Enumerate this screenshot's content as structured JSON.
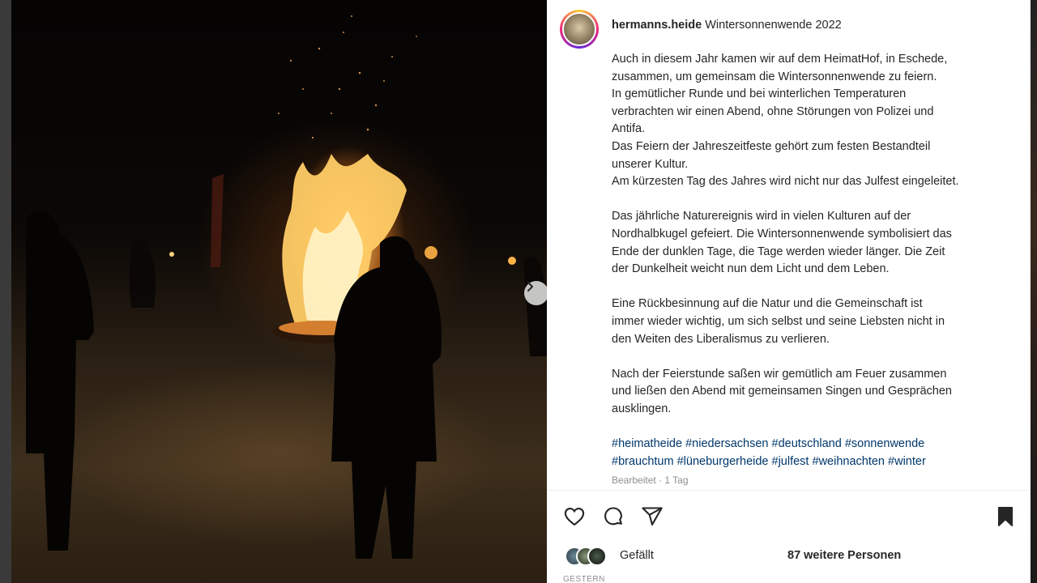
{
  "post": {
    "username": "hermanns.heide",
    "title": "Wintersonnenwende 2022",
    "caption_lines": [
      "Auch in diesem Jahr kamen wir auf dem HeimatHof, in Eschede,",
      "zusammen, um gemeinsam die Wintersonnenwende zu feiern.",
      "In gemütlicher Runde und bei winterlichen Temperaturen",
      "verbrachten wir einen Abend, ohne Störungen von Polizei und",
      "Antifa.",
      "Das Feiern der Jahreszeitfeste gehört zum festen Bestandteil",
      "unserer Kultur.",
      "Am kürzesten Tag des Jahres wird nicht nur das Julfest eingeleitet."
    ],
    "paragraph2_lines": [
      "Das jährliche Naturereignis wird in vielen Kulturen auf der",
      "Nordhalbkugel gefeiert. Die Wintersonnenwende symbolisiert das",
      "Ende der dunklen Tage, die Tage werden wieder länger. Die Zeit",
      "der Dunkelheit weicht nun dem Licht und dem Leben."
    ],
    "paragraph3_lines": [
      "Eine Rückbesinnung auf die Natur und die Gemeinschaft ist",
      "immer wieder wichtig, um sich selbst und seine Liebsten nicht in",
      "den Weiten des Liberalismus zu verlieren."
    ],
    "paragraph4_lines": [
      "Nach der Feierstunde saßen wir gemütlich am Feuer zusammen",
      "und ließen den Abend mit gemeinsamen Singen und Gesprächen",
      "ausklingen."
    ],
    "hashtags_line1": [
      "#heimatheide",
      "#niedersachsen",
      "#deutschland",
      "#sonnenwende"
    ],
    "hashtags_line2": [
      "#brauchtum",
      "#lüneburgerheide",
      "#julfest",
      "#weihnachten",
      "#winter"
    ],
    "edited": "Bearbeitet · 1 Tag",
    "liked_by_prefix": "Gefällt",
    "liked_by_rest": "87 weitere Personen",
    "timestamp": "GESTERN"
  },
  "icons": {
    "like": "heart-icon",
    "comment": "comment-icon",
    "share": "share-icon",
    "save": "bookmark-icon",
    "next": "chevron-right-icon"
  },
  "colors": {
    "link": "#00376b",
    "text": "#262626",
    "muted": "#8e8e8e"
  }
}
